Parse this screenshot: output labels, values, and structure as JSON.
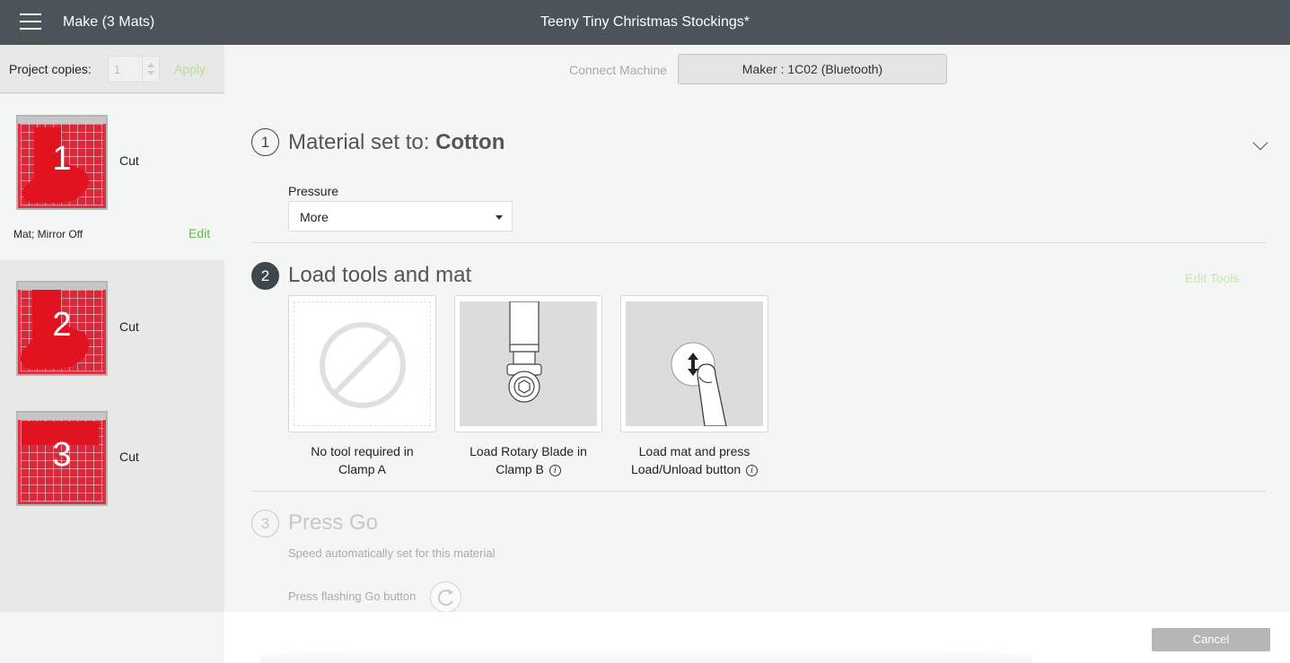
{
  "header": {
    "make_title": "Make (3 Mats)",
    "project_title": "Teeny Tiny Christmas Stockings*"
  },
  "sidebar": {
    "copies_label": "Project copies:",
    "copies_value": "1",
    "apply_label": "Apply",
    "mats": [
      {
        "number": "1",
        "action": "Cut",
        "meta": "Mat; Mirror Off",
        "edit_label": "Edit",
        "active": true
      },
      {
        "number": "2",
        "action": "Cut",
        "active": false
      },
      {
        "number": "3",
        "action": "Cut",
        "active": false
      }
    ]
  },
  "main": {
    "connect_label": "Connect Machine",
    "machine_label": "Maker : 1C02 (Bluetooth)",
    "step1": {
      "number": "1",
      "title_prefix": "Material set to: ",
      "material": "Cotton",
      "pressure_label": "Pressure",
      "pressure_value": "More"
    },
    "step2": {
      "number": "2",
      "title": "Load tools and mat",
      "edit_tools_label": "Edit Tools",
      "tools": [
        {
          "line1": "No tool required in",
          "line2": "Clamp A",
          "icon": "no-tool-icon"
        },
        {
          "line1": "Load Rotary Blade in",
          "line2": "Clamp B",
          "icon": "rotary-blade-icon",
          "info": true
        },
        {
          "line1": "Load mat and press",
          "line2": "Load/Unload button",
          "icon": "load-unload-icon",
          "info": true
        }
      ]
    },
    "step3": {
      "number": "3",
      "title": "Press Go",
      "speed_text": "Speed automatically set for this material",
      "go_text": "Press flashing Go button"
    }
  },
  "footer": {
    "cancel_label": "Cancel"
  },
  "colors": {
    "header_bg": "#4a5459",
    "accent_green": "#5fbb46",
    "mat_red": "#d62a3c"
  }
}
